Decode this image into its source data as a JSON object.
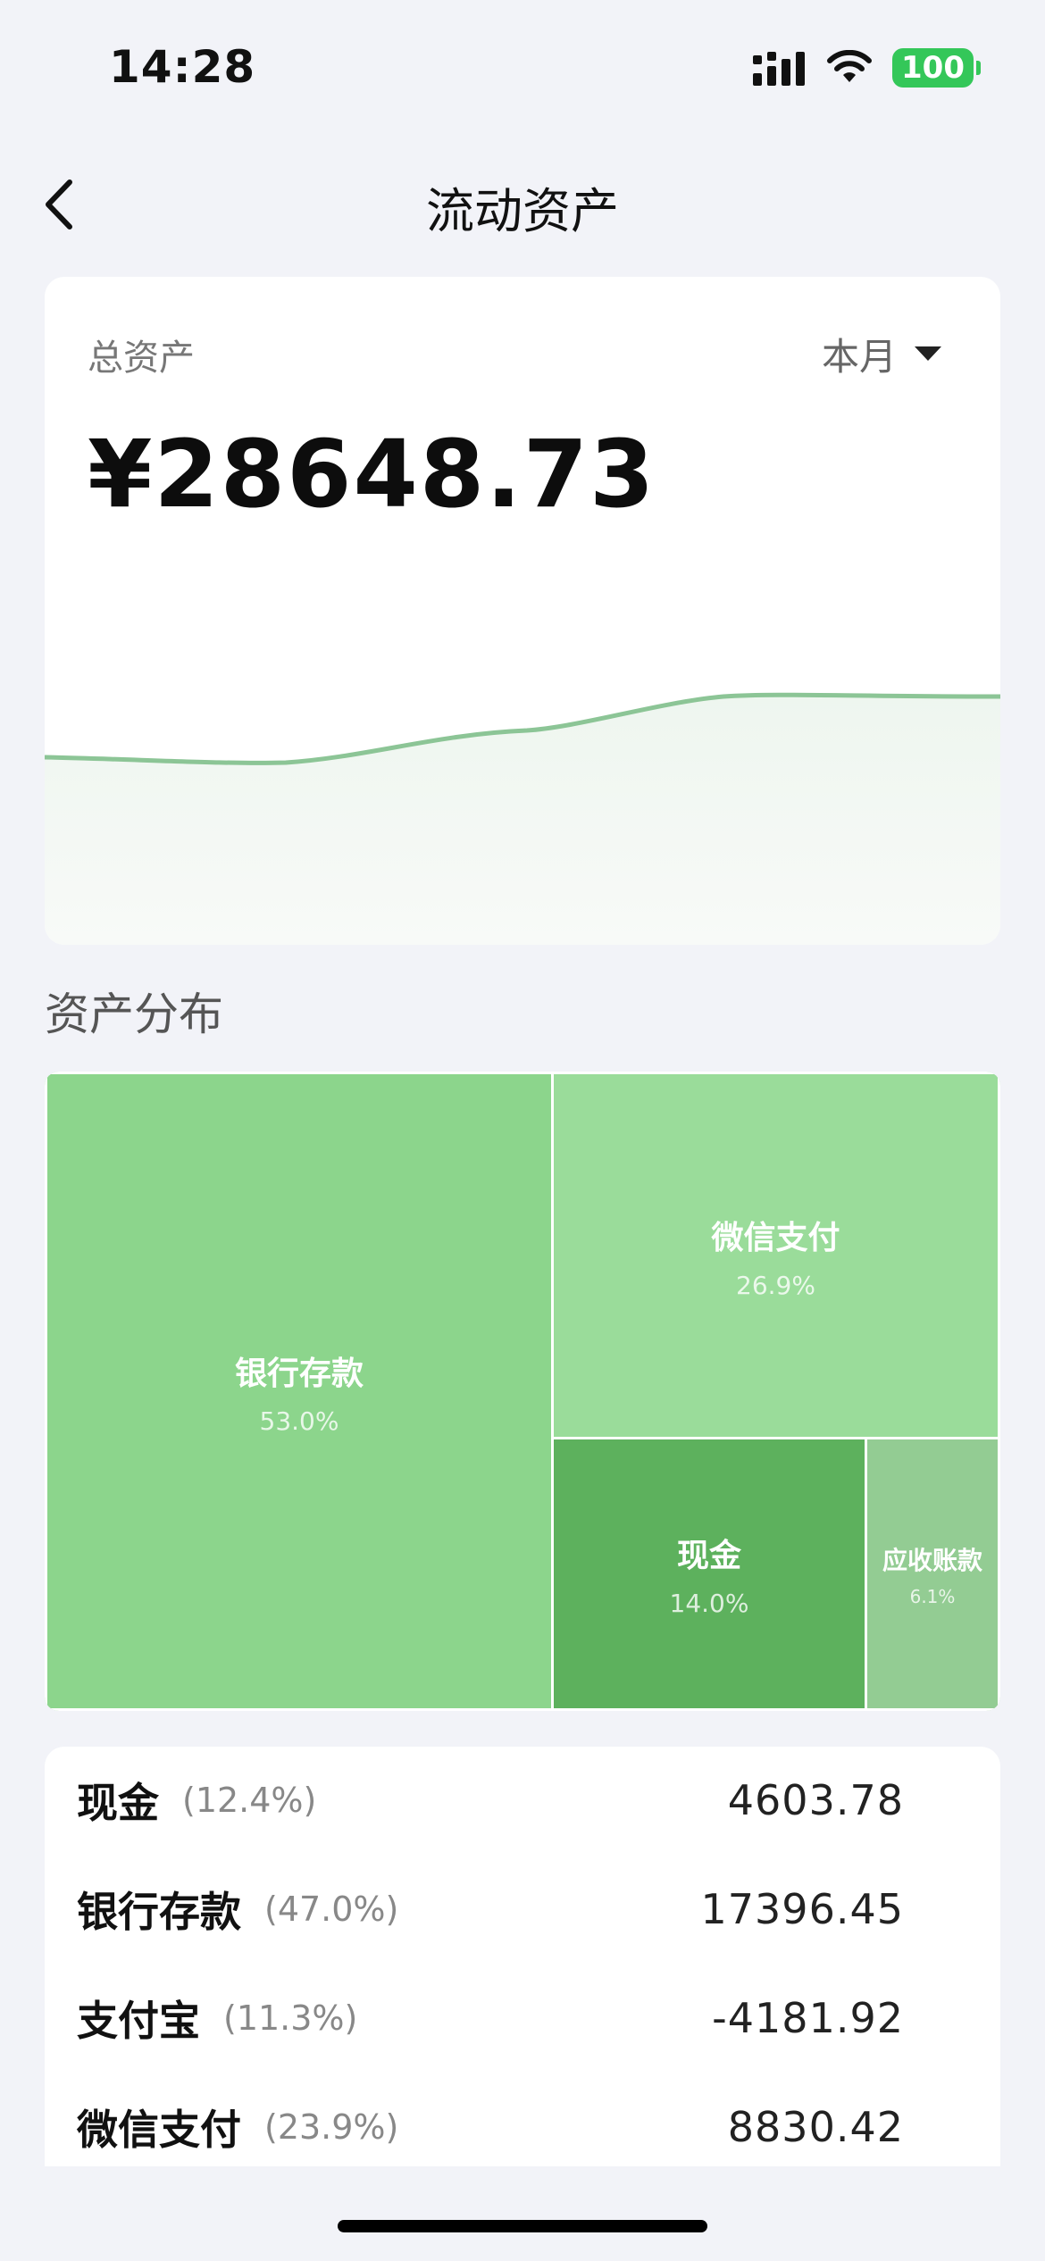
{
  "status_bar": {
    "time": "14:28",
    "battery": "100"
  },
  "nav": {
    "title": "流动资产"
  },
  "summary": {
    "label": "总资产",
    "period": "本月",
    "total": "¥28648.73"
  },
  "section_title": "资产分布",
  "treemap": [
    {
      "name": "银行存款",
      "pct": "53.0%",
      "color": "#8cd58c"
    },
    {
      "name": "微信支付",
      "pct": "26.9%",
      "color": "#9adc9a"
    },
    {
      "name": "现金",
      "pct": "14.0%",
      "color": "#5db15d"
    },
    {
      "name": "应收账款",
      "pct": "6.1%",
      "color": "#93cc93"
    }
  ],
  "assets": [
    {
      "name": "现金",
      "pct": "(12.4%)",
      "value": "4603.78"
    },
    {
      "name": "银行存款",
      "pct": "(47.0%)",
      "value": "17396.45"
    },
    {
      "name": "支付宝",
      "pct": "(11.3%)",
      "value": "-4181.92"
    },
    {
      "name": "微信支付",
      "pct": "(23.9%)",
      "value": "8830.42"
    }
  ],
  "colors": {
    "accent_line": "#8cc596",
    "background": "#f2f3f8"
  }
}
